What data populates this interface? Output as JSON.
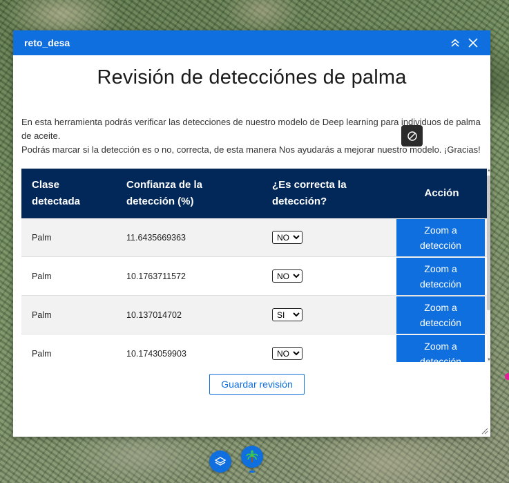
{
  "widget": {
    "title": "reto_desa",
    "heading": "Revisión de detecciónes de palma",
    "intro_line1": "En esta herramienta podrás verificar las detecciones de nuestro modelo de Deep learning para individuos de palma de aceite.",
    "intro_line2": "Podrás marcar si la detección es o no, correcta, de esta manera Nos ayudarás a mejorar nuestro modelo. ¡Gracias!"
  },
  "table": {
    "headers": {
      "clase_1": "Clase",
      "clase_2": "detectada",
      "conf_1": "Confianza de la",
      "conf_2": "detección (%)",
      "correct_1": "¿Es correcta la",
      "correct_2": "detección?",
      "action": "Acción"
    },
    "select_options": [
      "NO",
      "SI"
    ],
    "zoom_line1": "Zoom a",
    "zoom_line2": "detección",
    "rows": [
      {
        "clase": "Palm",
        "confianza": "11.6435669363",
        "correcta": "NO"
      },
      {
        "clase": "Palm",
        "confianza": "10.1763711572",
        "correcta": "NO"
      },
      {
        "clase": "Palm",
        "confianza": "10.137014702",
        "correcta": "SI"
      },
      {
        "clase": "Palm",
        "confianza": "10.1743059903",
        "correcta": "NO"
      }
    ]
  },
  "buttons": {
    "save": "Guardar revisión"
  },
  "colors": {
    "accent": "#0f6fde",
    "header_bg": "#022859",
    "marker": "#e21c97"
  },
  "icons": [
    "collapse-icon",
    "close-icon",
    "disabled-icon",
    "layers-icon",
    "palm-tree-icon",
    "resize-grip-icon"
  ]
}
